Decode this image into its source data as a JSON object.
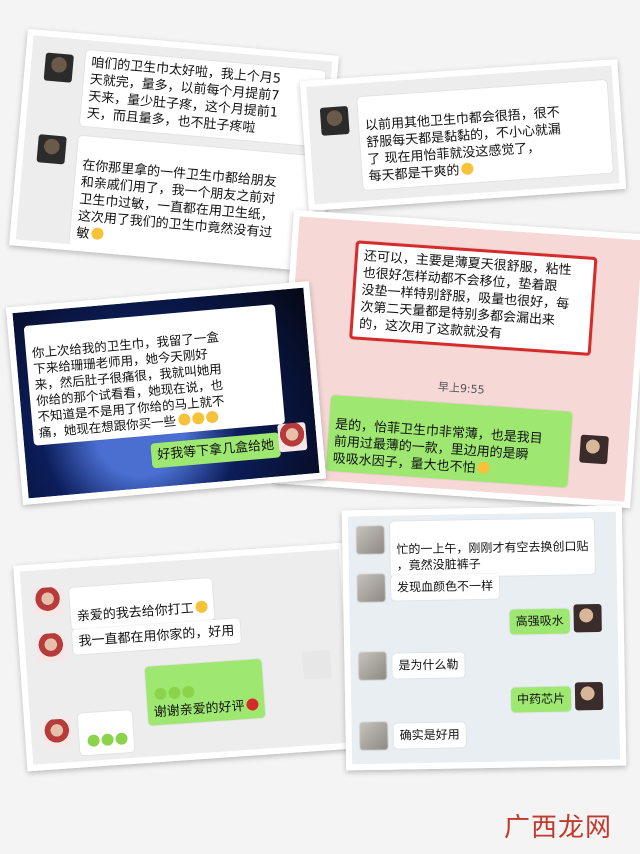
{
  "colors": {
    "accent_green": "#9ee871",
    "highlight_red": "#d62b2b",
    "watermark_red": "#c0392b"
  },
  "cards": {
    "c1": {
      "m1": "咱们的卫生巾太好啦，我上个月5\n天就完，量多，以前每个月提前7\n天来，量少肚子疼，这个月提前1\n天，而且量多，也不肚子疼啦",
      "m2": "在你那里拿的一件卫生巾都给朋友\n和亲戚们用了，我一个朋友之前对\n卫生巾过敏，一直都在用卫生纸，\n这次用了我们的卫生巾竟然没有过\n敏"
    },
    "c2": {
      "m1": "以前用其他卫生巾都会很捂，很不\n舒服每天都是黏黏的，不小心就漏\n了      现在用怡菲就没这感觉了，\n每天都是干爽的"
    },
    "c3": {
      "m1": "还可以，主要是薄夏天很舒服，粘性\n也很好怎样动都不会移位，垫着跟\n没垫一样特别舒服，吸量也很好，每\n次第二天量都是特别多都会漏出来\n的，这次用了这款就没有",
      "time": "早上9:55",
      "m2": "是的，怡菲卫生巾非常薄，也是我目\n前用过最薄的一款，里边用的是瞬\n吸吸水因子，量大也不怕"
    },
    "c4": {
      "m1": "你上次给我的卫生巾，我留了一盒\n下来给珊珊老师用，她今天刚好\n来，然后肚子很痛很，我就叫她用\n你给的那个试看看，她现在说，也\n不知道是不是用了你给的马上就不\n痛，她现在想跟你买一些",
      "m2": "好我等下拿几盒给她"
    },
    "c5": {
      "m1": "亲爱的我去给你打工",
      "m2": "我一直都在用你家的，好用",
      "m3": "谢谢亲爱的好评"
    },
    "c6": {
      "m1": "忙的一上午，刚刚才有空去换创口贴\n    ，竟然没脏裤子",
      "m2": "发现血颜色不一样",
      "m3": "高强吸水",
      "m4": "是为什么勒",
      "m5": "中药芯片",
      "m6": "确实是好用"
    }
  },
  "watermark": "广西龙网"
}
